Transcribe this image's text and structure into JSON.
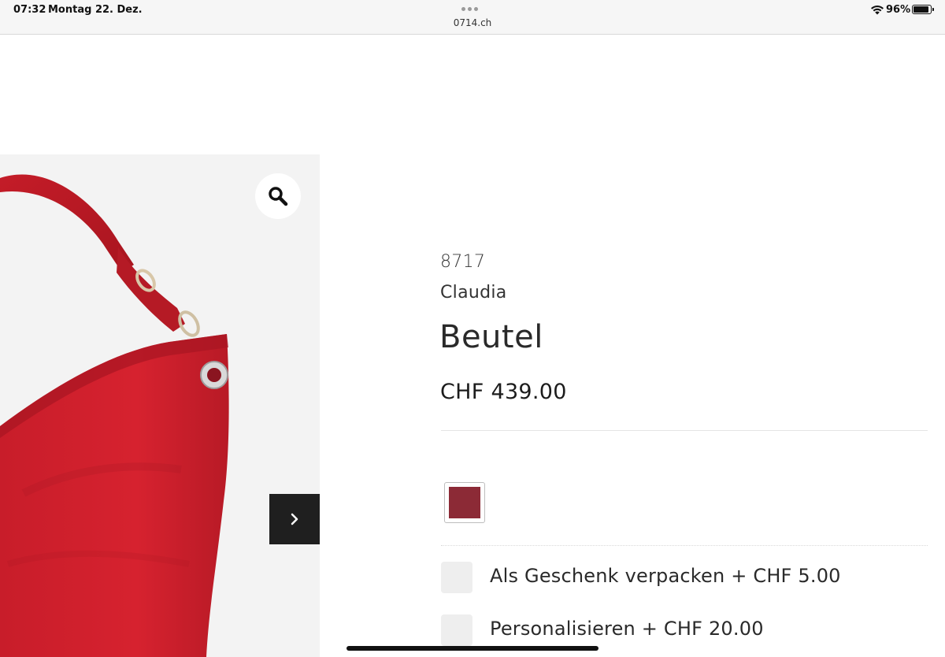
{
  "status_bar": {
    "time": "07:32",
    "date": "Montag 22. Dez.",
    "url": "0714.ch",
    "battery_percent": "96%",
    "battery_level": 0.96
  },
  "gallery": {
    "zoom_icon": "magnifier-icon",
    "next_icon": "chevron-right-icon",
    "bag_color": "#d11f2e",
    "background": "#f3f3f3"
  },
  "product": {
    "sku": "8717",
    "brand": "Claudia",
    "title": "Beutel",
    "price": "CHF 439.00",
    "color_swatch": "#8c2a36"
  },
  "options": [
    {
      "label": "Als Geschenk verpacken + CHF 5.00",
      "checked": false
    },
    {
      "label": "Personalisieren + CHF 20.00",
      "checked": false
    }
  ]
}
